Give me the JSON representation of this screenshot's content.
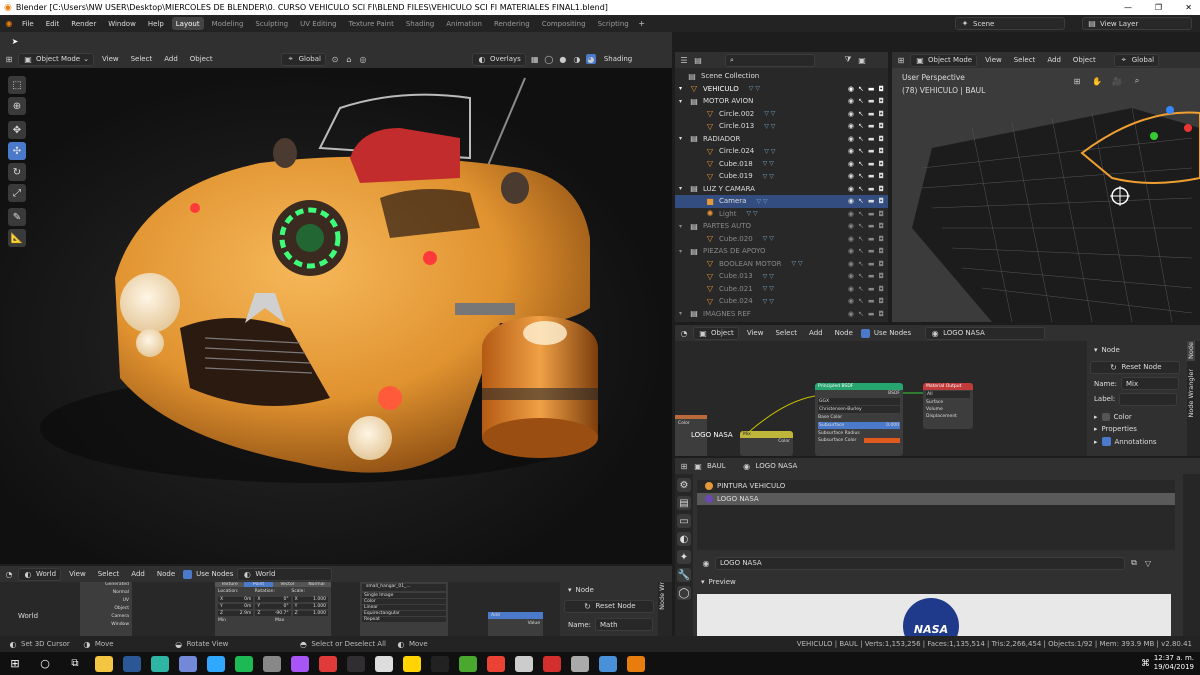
{
  "title": "Blender [C:\\Users\\NW USER\\Desktop\\MIERCOLES DE BLENDER\\0. CURSO VEHICULO SCI FI\\BLEND FILES\\VEHICULO SCI FI MATERIALES FINAL1.blend]",
  "menu": [
    "File",
    "Edit",
    "Render",
    "Window",
    "Help"
  ],
  "workspaces": [
    "Layout",
    "Modeling",
    "Sculpting",
    "UV Editing",
    "Texture Paint",
    "Shading",
    "Animation",
    "Rendering",
    "Compositing",
    "Scripting"
  ],
  "scene_name": "Scene",
  "view_layer": "View Layer",
  "viewport": {
    "mode": "Object Mode",
    "menus": [
      "View",
      "Select",
      "Add",
      "Object"
    ],
    "transform": "Global",
    "overlays": "Overlays",
    "shading": "Shading"
  },
  "outliner": {
    "root": "Scene Collection",
    "items": [
      {
        "label": "VEHICULO",
        "level": 0,
        "kind": "obj",
        "state": "active"
      },
      {
        "label": "MOTOR AVION",
        "level": 0,
        "kind": "coll",
        "state": "normal"
      },
      {
        "label": "Circle.002",
        "level": 1,
        "kind": "mesh",
        "state": "normal"
      },
      {
        "label": "Circle.013",
        "level": 1,
        "kind": "mesh",
        "state": "normal"
      },
      {
        "label": "RADIADOR",
        "level": 0,
        "kind": "coll",
        "state": "normal"
      },
      {
        "label": "Circle.024",
        "level": 1,
        "kind": "mesh",
        "state": "normal"
      },
      {
        "label": "Cube.018",
        "level": 1,
        "kind": "mesh",
        "state": "normal"
      },
      {
        "label": "Cube.019",
        "level": 1,
        "kind": "mesh",
        "state": "normal"
      },
      {
        "label": "LUZ Y CAMARA",
        "level": 0,
        "kind": "coll",
        "state": "normal"
      },
      {
        "label": "Camera",
        "level": 1,
        "kind": "cam",
        "state": "selected"
      },
      {
        "label": "Light",
        "level": 1,
        "kind": "light",
        "state": "dim"
      },
      {
        "label": "PARTES AUTO",
        "level": 0,
        "kind": "coll",
        "state": "dim"
      },
      {
        "label": "Cube.020",
        "level": 1,
        "kind": "mesh",
        "state": "dim"
      },
      {
        "label": "PIEZAS DE APOYO",
        "level": 0,
        "kind": "coll",
        "state": "dim"
      },
      {
        "label": "BOOLEAN MOTOR",
        "level": 1,
        "kind": "mesh",
        "state": "dim"
      },
      {
        "label": "Cube.013",
        "level": 1,
        "kind": "mesh",
        "state": "dim"
      },
      {
        "label": "Cube.021",
        "level": 1,
        "kind": "mesh",
        "state": "dim"
      },
      {
        "label": "Cube.024",
        "level": 1,
        "kind": "mesh",
        "state": "dim"
      },
      {
        "label": "IMAGNES REF",
        "level": 0,
        "kind": "coll",
        "state": "dim"
      }
    ]
  },
  "rv": {
    "mode": "Object Mode",
    "menus": [
      "View",
      "Select",
      "Add",
      "Object"
    ],
    "transform": "Global",
    "persp": "User Perspective",
    "obj": "(78) VEHICULO | BAUL"
  },
  "node_editor": {
    "object": "Object",
    "menus": [
      "View",
      "Select",
      "Add",
      "Node"
    ],
    "use_nodes": "Use Nodes",
    "material": "LOGO NASA",
    "bsdf_title": "Principled BSDF",
    "bsdf_rows": [
      "BSDF",
      "GGX",
      "Christensen-Burley",
      "Base Color",
      "Subsurface",
      "Subsurface Radius",
      "Subsurface Color"
    ],
    "subsurface_val": "0.000",
    "out_title": "Material Output",
    "out_rows": [
      "All",
      "Surface",
      "Volume",
      "Displacement"
    ],
    "mix_title": "Mix",
    "mix_row": "Color",
    "color_row": "Color",
    "logo_label": "LOGO NASA"
  },
  "npanel": {
    "title": "Node",
    "reset": "Reset Node",
    "name_label": "Name:",
    "name_val": "Mix",
    "label_label": "Label:",
    "color": "Color",
    "properties": "Properties",
    "annotations": "Annotations",
    "tabs": [
      "Node",
      "Node Wrangler"
    ]
  },
  "props": {
    "obj": "BAUL",
    "mat": "LOGO NASA",
    "slots": [
      "PINTURA VEHICULO",
      "LOGO NASA"
    ],
    "mat_field": "LOGO NASA",
    "preview": "Preview",
    "nasa": "NASA"
  },
  "world_editor": {
    "type": "World",
    "menus": [
      "View",
      "Select",
      "Add",
      "Node"
    ],
    "use_nodes": "Use Nodes",
    "world": "World",
    "left_label": "World",
    "coords": [
      "Generated",
      "Normal",
      "UV",
      "Object",
      "Camera",
      "Window"
    ],
    "mapping_tabs": [
      "Texture",
      "Point",
      "Vector",
      "Normal"
    ],
    "mapping_heads": [
      "Location:",
      "Rotation:",
      "Scale:"
    ],
    "mapping_rows": [
      [
        "X",
        "0m",
        "X",
        "0°",
        "X",
        "1.000"
      ],
      [
        "Y",
        "0m",
        "Y",
        "0°",
        "Y",
        "1.000"
      ],
      [
        "Z",
        "2.9m",
        "Z",
        "-90.7°",
        "Z",
        "1.000"
      ]
    ],
    "min": "Min",
    "max": "Max",
    "img": "small_hangar_01_...",
    "img_rows": [
      "Single Image",
      "Color",
      "Linear",
      "Equirectangular",
      "Repeat"
    ],
    "add_title": "Add",
    "add_row": "Value",
    "node_panel": "Node",
    "reset": "Reset Node",
    "name_label": "Name:",
    "name_val": "Math",
    "tab": "Node Wr"
  },
  "status": {
    "items": [
      "Set 3D Cursor",
      "Move",
      "Rotate View",
      "Select or Deselect All",
      "Move"
    ],
    "info": "VEHICULO | BAUL | Verts:1,153,256 | Faces:1,135,514 | Tris:2,266,454 | Objects:1/92 | Mem: 393.9 MB | v2.80.41"
  },
  "taskbar": {
    "time": "12:37 a. m.",
    "date": "19/04/2019",
    "apps": [
      "Explorer",
      "Word",
      "Maya",
      "Discord",
      "Photoshop",
      "Spotify",
      "Capture",
      "xN",
      "Sketchup",
      "Obs",
      "Zbrush",
      "Mari",
      "Epic",
      "Camtasia",
      "Chrome",
      "UE4",
      "Affinity",
      "Ableton",
      "Maps",
      "Blender"
    ]
  },
  "colors": {
    "accent": "#4a7ac9",
    "orange": "#e6973a",
    "bsdf": "#27a56e",
    "out": "#c23b3b",
    "mixnode": "#bfb73a"
  }
}
